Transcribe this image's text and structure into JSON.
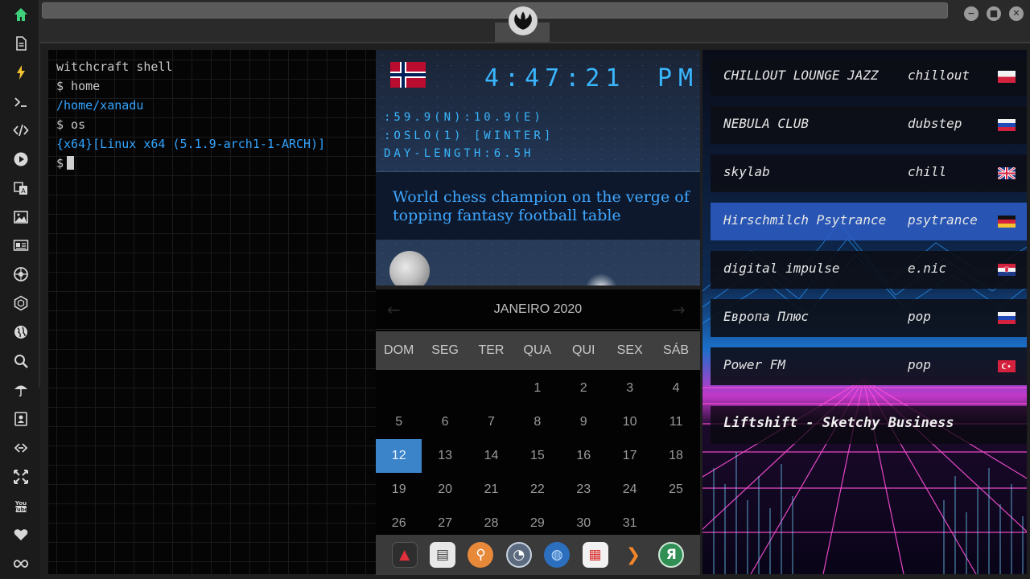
{
  "topbar": {
    "window_controls": [
      {
        "name": "minimize-icon",
        "glyph": "−"
      },
      {
        "name": "maximize-icon",
        "glyph": "■"
      },
      {
        "name": "close-icon",
        "glyph": "✕"
      }
    ],
    "logo_icon": "rebel-alliance-logo-icon"
  },
  "sidebar": {
    "items": [
      {
        "name": "home-icon",
        "color": "#3fd17a"
      },
      {
        "name": "document-icon"
      },
      {
        "name": "lightning-icon",
        "color": "#f2c230"
      },
      {
        "name": "terminal-icon"
      },
      {
        "name": "code-icon"
      },
      {
        "name": "play-icon"
      },
      {
        "name": "translate-icon"
      },
      {
        "name": "image-icon"
      },
      {
        "name": "news-icon"
      },
      {
        "name": "rebel-icon"
      },
      {
        "name": "hexagon-icon"
      },
      {
        "name": "globe-icon"
      },
      {
        "name": "search-icon"
      },
      {
        "name": "umbrella-icon"
      },
      {
        "name": "contacts-icon"
      },
      {
        "name": "link-icon"
      },
      {
        "name": "expand-icon"
      },
      {
        "name": "youtube-icon"
      },
      {
        "name": "heart-icon"
      },
      {
        "name": "infinity-icon"
      }
    ]
  },
  "terminal": {
    "lines": [
      {
        "text": "witchcraft shell",
        "color": "white"
      },
      {
        "text": "$ home",
        "color": "white"
      },
      {
        "text": "/home/xanadu",
        "color": "blue"
      },
      {
        "text": "$ os",
        "color": "white"
      },
      {
        "text": "{x64}[Linux x64 (5.1.9-arch1-1-ARCH)]",
        "color": "blue"
      }
    ],
    "prompt": "$"
  },
  "clock": {
    "time": "4:47:21",
    "ampm": "PM",
    "coords": ":59.9(N):10.9(E)",
    "location": ":OSLO(1) [WINTER]",
    "day_length": "DAY-LENGTH:6.5H",
    "news": "World chess champion on the verge of topping fantasy football table",
    "accent": "#3ab6ff"
  },
  "calendar": {
    "title": "JANEIRO 2020",
    "prev": "←",
    "next": "→",
    "weekdays": [
      "DOM",
      "SEG",
      "TER",
      "QUA",
      "QUI",
      "SEX",
      "SÁB"
    ],
    "weeks": [
      [
        "",
        "",
        "",
        "1",
        "2",
        "3",
        "4"
      ],
      [
        "5",
        "6",
        "7",
        "8",
        "9",
        "10",
        "11"
      ],
      [
        "12",
        "13",
        "14",
        "15",
        "16",
        "17",
        "18"
      ],
      [
        "19",
        "20",
        "21",
        "22",
        "23",
        "24",
        "25"
      ],
      [
        "26",
        "27",
        "28",
        "29",
        "30",
        "31",
        ""
      ]
    ],
    "selected_day": "12",
    "selected_color": "#3b84c9"
  },
  "dock": {
    "items": [
      {
        "name": "app-a-icon",
        "glyph": "▲",
        "bg": "#3a3a3a",
        "fg": "#e0303a"
      },
      {
        "name": "news-reader-icon",
        "glyph": "▤",
        "bg": "#e8e8e8",
        "fg": "#444444"
      },
      {
        "name": "magnifier-app-icon",
        "glyph": "⚲",
        "bg": "#e8893a",
        "fg": "#ffffff"
      },
      {
        "name": "clock-app-icon",
        "glyph": "◔",
        "bg": "#5c6b80",
        "fg": "#ffffff"
      },
      {
        "name": "browser-icon",
        "glyph": "◍",
        "bg": "#2d6fbf",
        "fg": "#bfe0ff"
      },
      {
        "name": "calendar-app-icon",
        "glyph": "▦",
        "bg": "#f2f2f2",
        "fg": "#d8322f"
      },
      {
        "name": "forward-app-icon",
        "glyph": "❯",
        "bg": "#3a3a3a",
        "fg": "#f0852a"
      },
      {
        "name": "yandex-icon",
        "glyph": "Я",
        "bg": "#2f8f55",
        "fg": "#ffffff"
      }
    ]
  },
  "radio": {
    "stations": [
      {
        "name": "CHILLOUT LOUNGE JAZZ",
        "genre": "chillout",
        "flag": "pl",
        "active": false
      },
      {
        "name": "NEBULA CLUB",
        "genre": "dubstep",
        "flag": "ru",
        "active": false
      },
      {
        "name": "skylab",
        "genre": "chill",
        "flag": "gb",
        "active": false
      },
      {
        "name": "Hirschmilch Psytrance",
        "genre": "psytrance",
        "flag": "de",
        "active": true
      },
      {
        "name": "digital impulse",
        "genre": "e.nic",
        "flag": "hr",
        "active": false
      },
      {
        "name": "Европа Плюс",
        "genre": "pop",
        "flag": "ru",
        "active": false
      },
      {
        "name": "Power FM",
        "genre": "pop",
        "flag": "tr",
        "active": false
      }
    ],
    "now_playing": "Liftshift - Sketchy Business"
  }
}
